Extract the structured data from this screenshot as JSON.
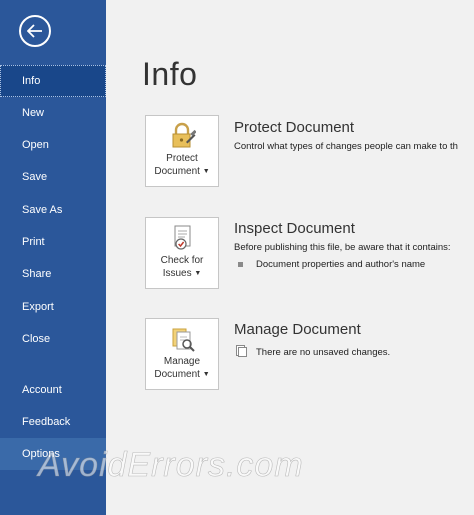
{
  "sidebar": {
    "items": [
      {
        "label": "Info"
      },
      {
        "label": "New"
      },
      {
        "label": "Open"
      },
      {
        "label": "Save"
      },
      {
        "label": "Save As"
      },
      {
        "label": "Print"
      },
      {
        "label": "Share"
      },
      {
        "label": "Export"
      },
      {
        "label": "Close"
      },
      {
        "label": "Account"
      },
      {
        "label": "Feedback"
      },
      {
        "label": "Options"
      }
    ],
    "back_icon": "back-arrow-icon"
  },
  "main": {
    "title": "Info",
    "sections": [
      {
        "button_line1": "Protect",
        "button_line2": "Document",
        "icon": "lock-icon",
        "title": "Protect Document",
        "description": "Control what types of changes people can make to th"
      },
      {
        "button_line1": "Check for",
        "button_line2": "Issues",
        "icon": "check-document-icon",
        "title": "Inspect Document",
        "description": "Before publishing this file, be aware that it contains:",
        "bullet": "Document properties and author's name"
      },
      {
        "button_line1": "Manage",
        "button_line2": "Document",
        "icon": "manage-document-icon",
        "title": "Manage Document",
        "bullet": "There are no unsaved changes."
      }
    ]
  },
  "watermark": "AvoidErrors.com",
  "colors": {
    "sidebar": "#2b579a",
    "sidebar_active": "#19478a",
    "content_bg": "#f1f1f1"
  }
}
